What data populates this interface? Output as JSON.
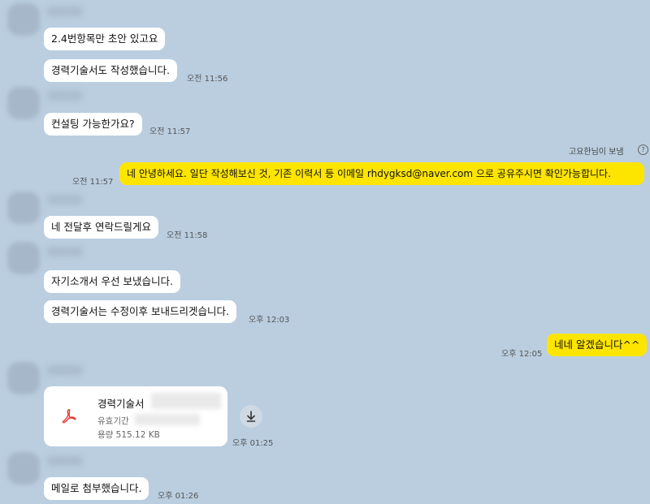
{
  "messages": {
    "m1": {
      "text": "2.4번항목만 초안 있고요"
    },
    "m2": {
      "text": "경력기술서도 작성했습니다.",
      "time": "오전 11:56"
    },
    "m3": {
      "text": "컨설팅 가능한가요?",
      "time": "오전 11:57"
    },
    "m4": {
      "sender": "고요한님이 보냄",
      "text": "네 안녕하세요. 일단 작성해보신 것, 기존 이력서 등 이메일 rhdygksd@naver.com 으로 공유주시면 확인가능합니다.",
      "time": "오전 11:57"
    },
    "m5": {
      "text": "네 전달후 연락드릴게요",
      "time": "오전 11:58"
    },
    "m6": {
      "text": "자기소개서 우선 보냈습니다."
    },
    "m7": {
      "text": "경력기술서는 수정이후 보내드리겟습니다.",
      "time": "오후 12:03"
    },
    "m8": {
      "text": "네네 알겠습니다^^",
      "time": "오후 12:05"
    },
    "file": {
      "name": "경력기술서",
      "validity_label": "유효기간",
      "size_label": "용량 515.12 KB",
      "time": "오후 01:25",
      "icon": "pdf-icon",
      "download_icon": "download-icon"
    },
    "m9": {
      "text": "메일로 첨부했습니다.",
      "time": "오후 01:26"
    }
  },
  "colors": {
    "background": "#bacee0",
    "my_bubble": "#fee500",
    "other_bubble": "#ffffff"
  }
}
